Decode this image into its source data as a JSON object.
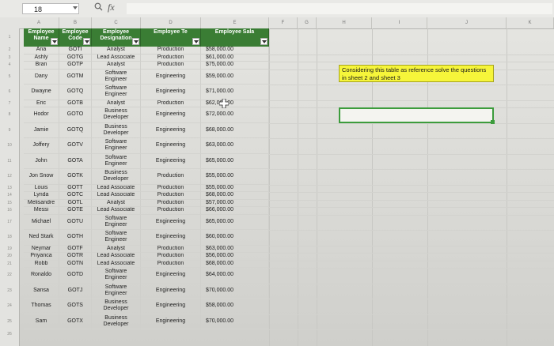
{
  "formula_bar": {
    "name_box": "18",
    "fx_label": "fx",
    "formula_value": ""
  },
  "columns": [
    "A",
    "B",
    "C",
    "D",
    "E",
    "F",
    "G",
    "H",
    "I",
    "J",
    "K"
  ],
  "rows": [
    "1",
    "2",
    "3",
    "4",
    "5",
    "6",
    "7",
    "8",
    "9",
    "10",
    "11",
    "12",
    "13",
    "14",
    "15",
    "16",
    "17",
    "18",
    "19",
    "20",
    "21",
    "22",
    "23",
    "24",
    "25",
    "26"
  ],
  "table": {
    "headers": [
      {
        "label": "Employee Name"
      },
      {
        "label": "Employee Code"
      },
      {
        "label": "Employee Designation"
      },
      {
        "label": "Employee Te"
      },
      {
        "label": "Employee Sala"
      }
    ],
    "rows": [
      {
        "name": "Ana",
        "code": "GOTI",
        "designation": "Analyst",
        "team": "Production",
        "salary": "$58,000.00"
      },
      {
        "name": "Ashly",
        "code": "GOTG",
        "designation": "Lead Associate",
        "team": "Production",
        "salary": "$61,000.00"
      },
      {
        "name": "Bran",
        "code": "GOTP",
        "designation": "Analyst",
        "team": "Production",
        "salary": "$75,000.00"
      },
      {
        "name": "Dany",
        "code": "GOTM",
        "designation": "Software Engineer",
        "team": "Engineering",
        "salary": "$59,000.00"
      },
      {
        "name": "Dwayne",
        "code": "GOTQ",
        "designation": "Software Engineer",
        "team": "Engineering",
        "salary": "$71,000.00"
      },
      {
        "name": "Eric",
        "code": "GOTB",
        "designation": "Analyst",
        "team": "Production",
        "salary": "$62,000.00"
      },
      {
        "name": "Hodor",
        "code": "GOTO",
        "designation": "Business Developer",
        "team": "Engineering",
        "salary": "$72,000.00"
      },
      {
        "name": "Jamie",
        "code": "GOTQ",
        "designation": "Business Developer",
        "team": "Engineering",
        "salary": "$68,000.00"
      },
      {
        "name": "Joffery",
        "code": "GOTV",
        "designation": "Software Engineer",
        "team": "Engineering",
        "salary": "$63,000.00"
      },
      {
        "name": "John",
        "code": "GOTA",
        "designation": "Software Engineer",
        "team": "Engineering",
        "salary": "$65,000.00"
      },
      {
        "name": "Jon Snow",
        "code": "GOTK",
        "designation": "Business Developer",
        "team": "Production",
        "salary": "$55,000.00"
      },
      {
        "name": "Louis",
        "code": "GOTT",
        "designation": "Lead Associate",
        "team": "Production",
        "salary": "$55,000.00"
      },
      {
        "name": "Lynda",
        "code": "GOTC",
        "designation": "Lead Associate",
        "team": "Production",
        "salary": "$68,000.00"
      },
      {
        "name": "Melisandre",
        "code": "GOTL",
        "designation": "Analyst",
        "team": "Production",
        "salary": "$57,000.00"
      },
      {
        "name": "Messi",
        "code": "GOTE",
        "designation": "Lead Associate",
        "team": "Production",
        "salary": "$66,000.00"
      },
      {
        "name": "Michael",
        "code": "GOTU",
        "designation": "Software Engineer",
        "team": "Engineering",
        "salary": "$65,000.00"
      },
      {
        "name": "Ned Stark",
        "code": "GOTH",
        "designation": "Software Engineer",
        "team": "Engineering",
        "salary": "$60,000.00"
      },
      {
        "name": "Neymar",
        "code": "GOTF",
        "designation": "Analyst",
        "team": "Production",
        "salary": "$63,000.00"
      },
      {
        "name": "Priyanca",
        "code": "GOTR",
        "designation": "Lead Associate",
        "team": "Production",
        "salary": "$56,000.00"
      },
      {
        "name": "Robb",
        "code": "GOTN",
        "designation": "Lead Associate",
        "team": "Production",
        "salary": "$68,000.00"
      },
      {
        "name": "Ronaldo",
        "code": "GOTD",
        "designation": "Software Engineer",
        "team": "Engineering",
        "salary": "$64,000.00"
      },
      {
        "name": "Sansa",
        "code": "GOTJ",
        "designation": "Software Engineer",
        "team": "Engineering",
        "salary": "$70,000.00"
      },
      {
        "name": "Thomas",
        "code": "GOTS",
        "designation": "Business Developer",
        "team": "Engineering",
        "salary": "$58,000.00"
      },
      {
        "name": "Sam",
        "code": "GOTX",
        "designation": "Business Developer",
        "team": "Engineering",
        "salary": "$70,000.00"
      }
    ]
  },
  "note": "Considering this table as reference solve the questions in sheet 2 and sheet 3"
}
